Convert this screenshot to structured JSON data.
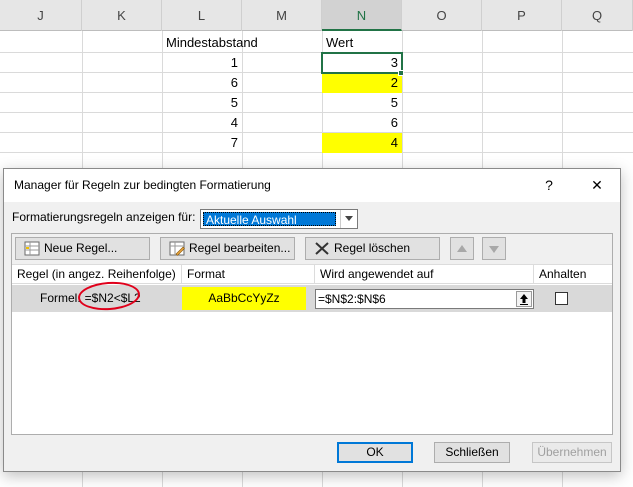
{
  "sheet": {
    "columns": [
      "J",
      "K",
      "L",
      "M",
      "N",
      "O",
      "P",
      "Q"
    ],
    "header_L": "Mindestabstand",
    "header_N": "Wert",
    "rows": [
      {
        "L": "1",
        "N": "3"
      },
      {
        "L": "6",
        "N": "2"
      },
      {
        "L": "5",
        "N": "5"
      },
      {
        "L": "4",
        "N": "6"
      },
      {
        "L": "7",
        "N": "4"
      }
    ],
    "highlight_color": "#ffff00",
    "selection_color": "#217346"
  },
  "dialog": {
    "title": "Manager für Regeln zur bedingten Formatierung",
    "help_label": "?",
    "close_label": "✕",
    "show_rules_label": "Formatierungsregeln anzeigen für:",
    "show_rules_value": "Aktuelle Auswahl",
    "toolbar": {
      "new_rule": "Neue Regel...",
      "edit_rule": "Regel bearbeiten...",
      "delete_rule": "Regel löschen"
    },
    "table": {
      "col_rule": "Regel (in angez. Reihenfolge)",
      "col_format": "Format",
      "col_applies": "Wird angewendet auf",
      "col_stop": "Anhalten"
    },
    "rule": {
      "type": "Formel:",
      "formula": "=$N2<$L2",
      "preview": "AaBbCcYyZz",
      "applies_to": "=$N$2:$N$6",
      "stop_if_true": false
    },
    "buttons": {
      "ok": "OK",
      "close": "Schließen",
      "apply": "Übernehmen"
    },
    "accent_color": "#0078d7",
    "annotation_color": "#e0001b"
  }
}
